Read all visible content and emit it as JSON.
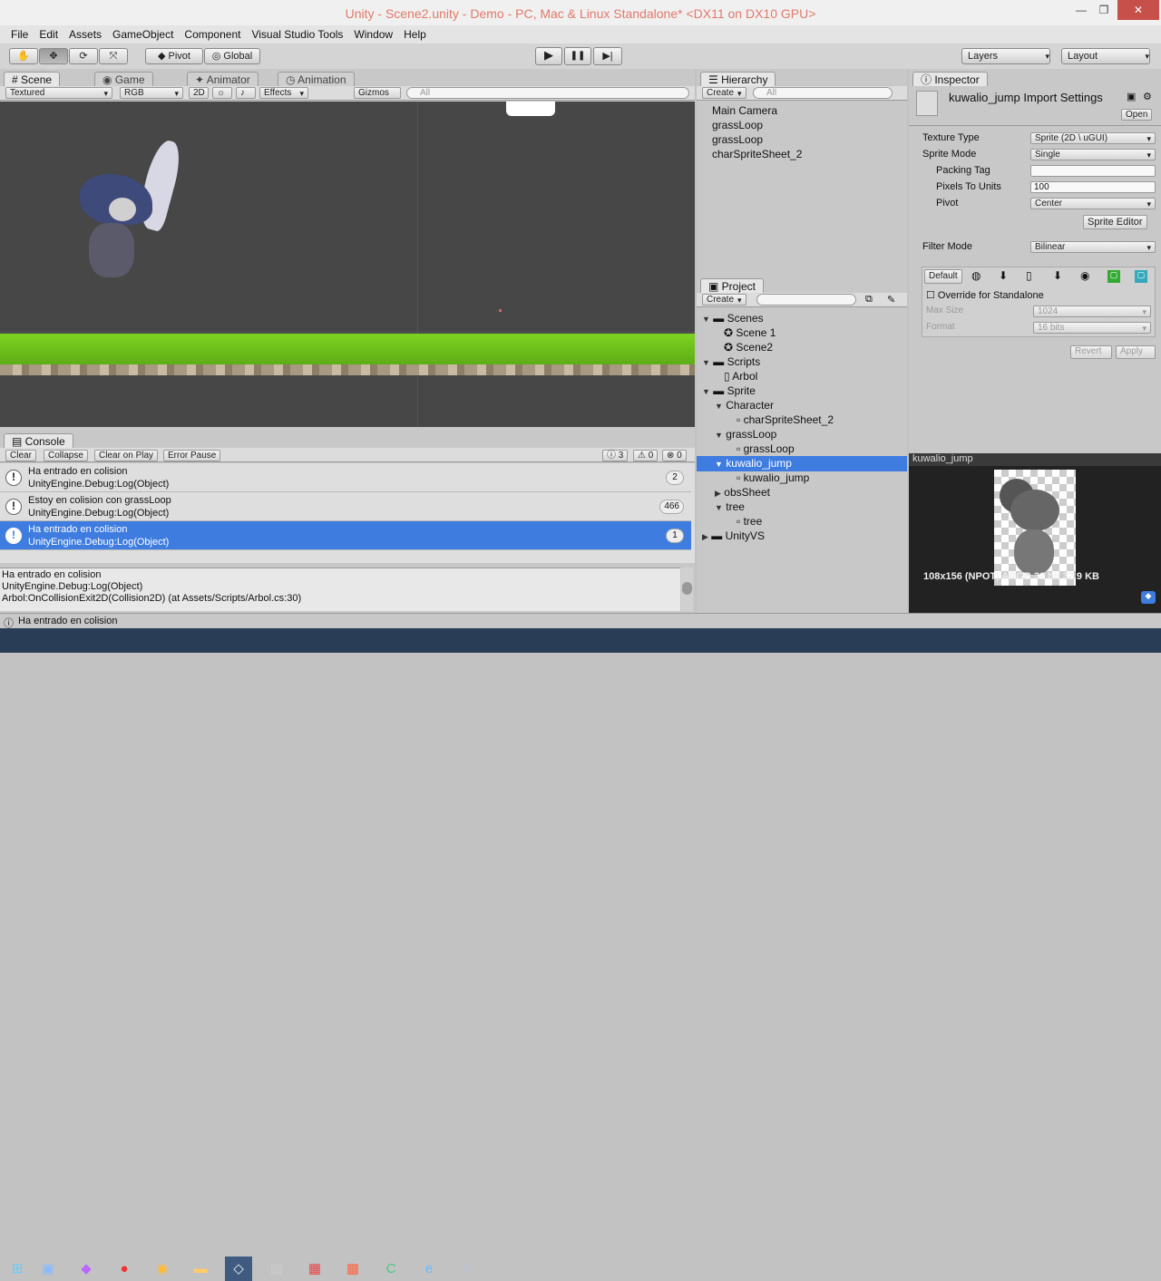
{
  "window": {
    "title": "Unity - Scene2.unity - Demo - PC, Mac & Linux Standalone* <DX11 on DX10 GPU>",
    "min": "—",
    "max": "❐",
    "close": "✕"
  },
  "menu": [
    "File",
    "Edit",
    "Assets",
    "GameObject",
    "Component",
    "Visual Studio Tools",
    "Window",
    "Help"
  ],
  "toolbar": {
    "pivot": "Pivot",
    "global": "Global",
    "layers": "Layers",
    "layout": "Layout",
    "play": "▶",
    "pause": "❚❚",
    "step": "▶|"
  },
  "scene": {
    "tabs": [
      "Scene",
      "Game",
      "Animator",
      "Animation"
    ],
    "shading": "Textured",
    "rgb": "RGB",
    "mode2d": "2D",
    "effects": "Effects",
    "gizmos": "Gizmos",
    "search": "All"
  },
  "hierarchy": {
    "tab": "Hierarchy",
    "create": "Create",
    "search": "All",
    "items": [
      "Main Camera",
      "grassLoop",
      "grassLoop",
      "charSpriteSheet_2"
    ]
  },
  "project": {
    "tab": "Project",
    "create": "Create",
    "items": [
      "Scenes",
      "Scene 1",
      "Scene2",
      "Scripts",
      "Arbol",
      "Sprite",
      "Character",
      "charSpriteSheet_2",
      "grassLoop",
      "grassLoop",
      "kuwalio_jump",
      "kuwalio_jump",
      "obsSheet",
      "tree",
      "tree",
      "UnityVS"
    ]
  },
  "inspector": {
    "tab": "Inspector",
    "title": "kuwalio_jump Import Settings",
    "open": "Open",
    "labels": [
      "Texture Type",
      "Sprite Mode",
      "Packing Tag",
      "Pixels To Units",
      "Pivot",
      "Filter Mode"
    ],
    "values": [
      "Sprite (2D \\ uGUI)",
      "Single",
      "",
      "100",
      "Center",
      "Bilinear"
    ],
    "sprite_editor": "Sprite Editor",
    "default": "Default",
    "override": "Override for Standalone",
    "max_size_label": "Max Size",
    "max_size": "1024",
    "format_label": "Format",
    "format": "16 bits",
    "revert": "Revert",
    "apply": "Apply"
  },
  "preview": {
    "name": "kuwalio_jump",
    "info": "108x156 (NPOT)  ARGB 32 bit    32.9 KB"
  },
  "console": {
    "tab": "Console",
    "buttons": [
      "Clear",
      "Collapse",
      "Clear on Play",
      "Error Pause"
    ],
    "counts": [
      "3",
      "0",
      "0"
    ],
    "rows": [
      {
        "t1": "Ha entrado en colision",
        "t2": "UnityEngine.Debug:Log(Object)",
        "n": "2"
      },
      {
        "t1": "Estoy en colision con grassLoop",
        "t2": "UnityEngine.Debug:Log(Object)",
        "n": "466"
      },
      {
        "t1": "Ha entrado en colision",
        "t2": "UnityEngine.Debug:Log(Object)",
        "n": "1"
      }
    ],
    "detail": [
      "Ha entrado en colision",
      "UnityEngine.Debug:Log(Object)",
      "Arbol:OnCollisionExit2D(Collision2D) (at Assets/Scripts/Arbol.cs:30)"
    ]
  },
  "status": "Ha entrado en colision",
  "colors": {
    "selection": "#3e7ce0",
    "sceneBg": "#474747",
    "grass": "#6bc31a"
  }
}
